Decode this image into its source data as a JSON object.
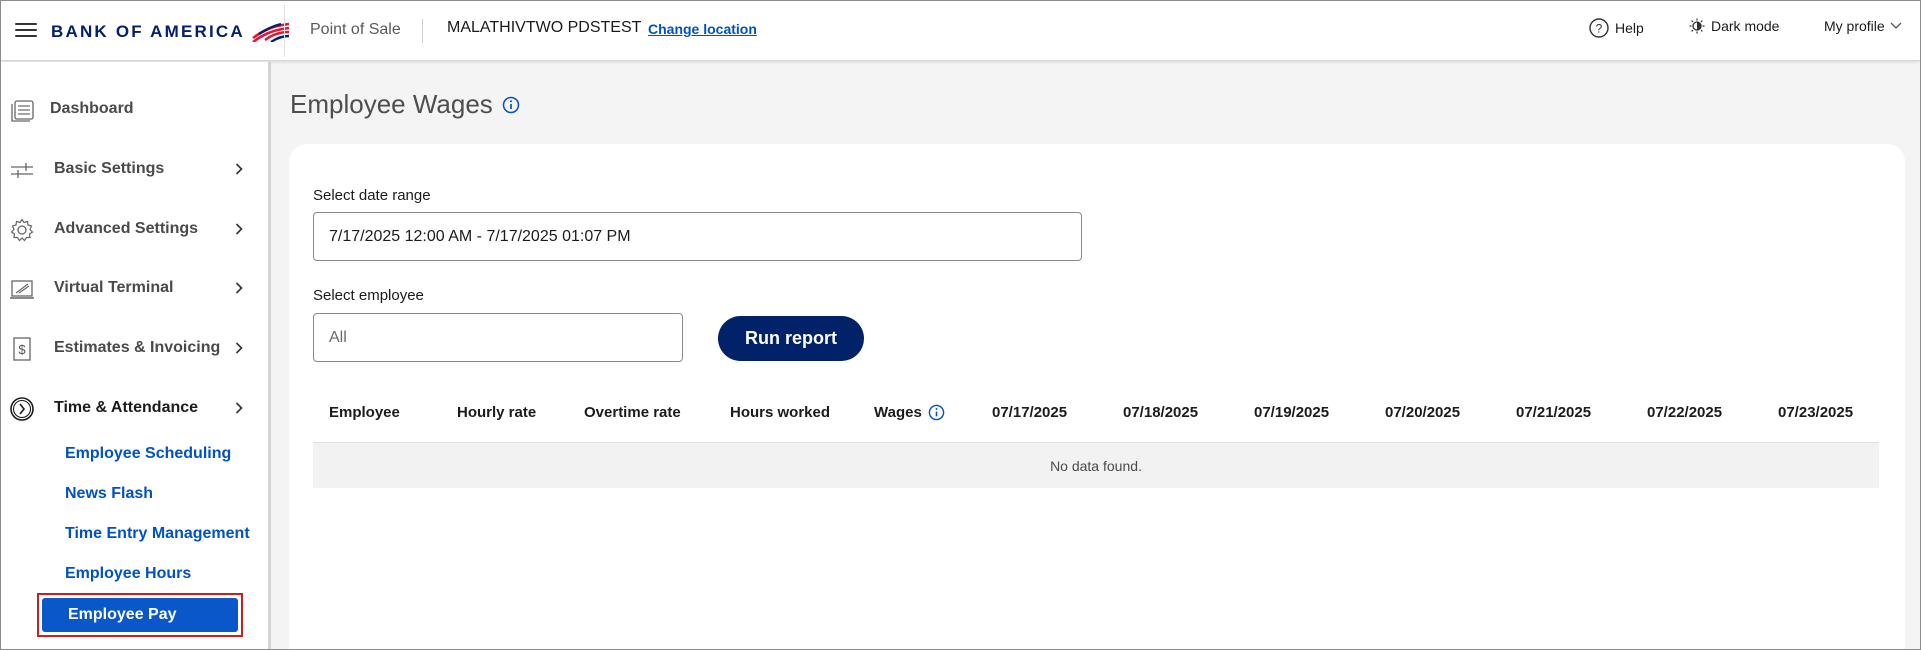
{
  "header": {
    "brand": "BANK OF AMERICA",
    "app_name": "Point of Sale",
    "merchant_name": "MALATHIVTWO PDSTEST",
    "change_location": "Change location",
    "help": "Help",
    "dark_mode": "Dark mode",
    "profile": "My profile"
  },
  "sidebar": {
    "items": [
      {
        "label": "Dashboard"
      },
      {
        "label": "Basic Settings"
      },
      {
        "label": "Advanced Settings"
      },
      {
        "label": "Virtual Terminal"
      },
      {
        "label": "Estimates & Invoicing"
      },
      {
        "label": "Time & Attendance"
      }
    ],
    "sub_items": [
      {
        "label": "Employee Scheduling"
      },
      {
        "label": "News Flash"
      },
      {
        "label": "Time Entry Management"
      },
      {
        "label": "Employee Hours"
      },
      {
        "label": "Employee Pay"
      }
    ]
  },
  "main": {
    "title": "Employee Wages",
    "date_range_label": "Select date range",
    "date_range_value": "7/17/2025 12:00 AM - 7/17/2025 01:07 PM",
    "employee_label": "Select employee",
    "employee_placeholder": "All",
    "run_report": "Run report",
    "columns": [
      "Employee",
      "Hourly rate",
      "Overtime rate",
      "Hours worked",
      "Wages",
      "07/17/2025",
      "07/18/2025",
      "07/19/2025",
      "07/20/2025",
      "07/21/2025",
      "07/22/2025",
      "07/23/2025"
    ],
    "no_data": "No data found."
  },
  "colors": {
    "brand_navy": "#012169",
    "brand_red": "#e31837",
    "link_blue": "#0052c2",
    "selected_blue": "#0a57c9",
    "highlight_red": "#d21c1c"
  }
}
